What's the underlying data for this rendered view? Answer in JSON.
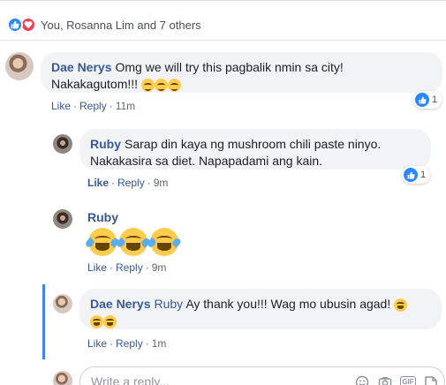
{
  "reactions": {
    "summary": "You, Rosanna Lim and 7 others",
    "icons": [
      "like-icon",
      "love-icon"
    ]
  },
  "comments": [
    {
      "author": "Dae Nerys",
      "text_line1": "Omg we will try this pagbalik nmin sa city!",
      "text_line2": "Nakakagutom!!!",
      "emojis": [
        "smiling-face-with-smiling-eyes",
        "smiling-face-with-smiling-eyes",
        "smiling-face-with-smiling-eyes"
      ],
      "like_count": "1",
      "like_label": "Like",
      "reply_label": "Reply",
      "time": "11m"
    }
  ],
  "replies": [
    {
      "author": "Ruby",
      "text_line1": "Sarap din kaya ng mushroom chili paste ninyo.",
      "text_line2": "Nakakasira sa diet. Napapadami ang kain.",
      "like_count": "1",
      "like_label": "Like",
      "reply_label": "Reply",
      "time": "9m"
    },
    {
      "author": "Ruby",
      "emojis": [
        "face-with-tears-of-joy",
        "face-with-tears-of-joy",
        "face-with-tears-of-joy"
      ],
      "like_label": "Like",
      "reply_label": "Reply",
      "time": "9m"
    },
    {
      "author": "Dae Nerys",
      "mention": "Ruby",
      "text": "Ay thank you!!! Wag mo ubusin agad!",
      "emojis": [
        "face-with-tears-of-joy",
        "face-with-tears-of-joy",
        "face-with-tears-of-joy"
      ],
      "like_label": "Like",
      "reply_label": "Reply",
      "time": "1m"
    }
  ],
  "reply_box": {
    "placeholder": "Write a reply...",
    "icons": [
      "emoji-icon",
      "camera-icon",
      "gif-icon",
      "sticker-icon"
    ]
  },
  "colors": {
    "link": "#385898",
    "like_blue": "#2d88ff",
    "love_red": "#f33e58",
    "bubble_bg": "#f2f3f5",
    "thread_bar": "#4080ff"
  }
}
